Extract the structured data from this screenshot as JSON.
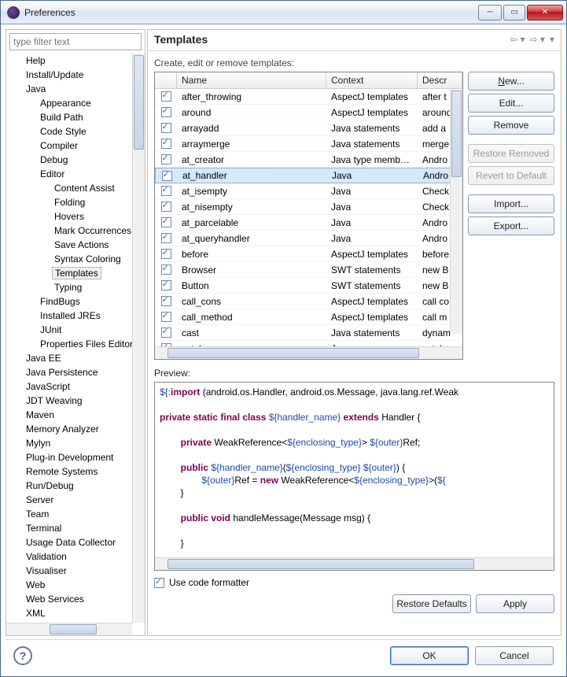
{
  "window": {
    "title": "Preferences"
  },
  "filter_placeholder": "type filter text",
  "tree": [
    {
      "label": "Help",
      "d": 0
    },
    {
      "label": "Install/Update",
      "d": 0
    },
    {
      "label": "Java",
      "d": 0
    },
    {
      "label": "Appearance",
      "d": 1
    },
    {
      "label": "Build Path",
      "d": 1
    },
    {
      "label": "Code Style",
      "d": 1
    },
    {
      "label": "Compiler",
      "d": 1
    },
    {
      "label": "Debug",
      "d": 1
    },
    {
      "label": "Editor",
      "d": 1
    },
    {
      "label": "Content Assist",
      "d": 2
    },
    {
      "label": "Folding",
      "d": 2
    },
    {
      "label": "Hovers",
      "d": 2
    },
    {
      "label": "Mark Occurrences",
      "d": 2
    },
    {
      "label": "Save Actions",
      "d": 2
    },
    {
      "label": "Syntax Coloring",
      "d": 2
    },
    {
      "label": "Templates",
      "d": 2,
      "sel": true
    },
    {
      "label": "Typing",
      "d": 2
    },
    {
      "label": "FindBugs",
      "d": 1
    },
    {
      "label": "Installed JREs",
      "d": 1
    },
    {
      "label": "JUnit",
      "d": 1
    },
    {
      "label": "Properties Files Editor",
      "d": 1
    },
    {
      "label": "Java EE",
      "d": 0
    },
    {
      "label": "Java Persistence",
      "d": 0
    },
    {
      "label": "JavaScript",
      "d": 0
    },
    {
      "label": "JDT Weaving",
      "d": 0
    },
    {
      "label": "Maven",
      "d": 0
    },
    {
      "label": "Memory Analyzer",
      "d": 0
    },
    {
      "label": "Mylyn",
      "d": 0
    },
    {
      "label": "Plug-in Development",
      "d": 0
    },
    {
      "label": "Remote Systems",
      "d": 0
    },
    {
      "label": "Run/Debug",
      "d": 0
    },
    {
      "label": "Server",
      "d": 0
    },
    {
      "label": "Team",
      "d": 0
    },
    {
      "label": "Terminal",
      "d": 0
    },
    {
      "label": "Usage Data Collector",
      "d": 0
    },
    {
      "label": "Validation",
      "d": 0
    },
    {
      "label": "Visualiser",
      "d": 0
    },
    {
      "label": "Web",
      "d": 0
    },
    {
      "label": "Web Services",
      "d": 0
    },
    {
      "label": "XML",
      "d": 0
    }
  ],
  "page": {
    "title": "Templates",
    "subhead": "Create, edit or remove templates:",
    "columns": {
      "name": "Name",
      "context": "Context",
      "desc": "Descr"
    },
    "rows": [
      {
        "name": "after_throwing",
        "ctx": "AspectJ templates",
        "desc": "after t"
      },
      {
        "name": "around",
        "ctx": "AspectJ templates",
        "desc": "around"
      },
      {
        "name": "arrayadd",
        "ctx": "Java statements",
        "desc": "add a"
      },
      {
        "name": "arraymerge",
        "ctx": "Java statements",
        "desc": "merge"
      },
      {
        "name": "at_creator",
        "ctx": "Java type members",
        "desc": "Andro"
      },
      {
        "name": "at_handler",
        "ctx": "Java",
        "desc": "Andro",
        "sel": true
      },
      {
        "name": "at_isempty",
        "ctx": "Java",
        "desc": "Check"
      },
      {
        "name": "at_nisempty",
        "ctx": "Java",
        "desc": "Check"
      },
      {
        "name": "at_parcelable",
        "ctx": "Java",
        "desc": "Andro"
      },
      {
        "name": "at_queryhandler",
        "ctx": "Java",
        "desc": "Andro"
      },
      {
        "name": "before",
        "ctx": "AspectJ templates",
        "desc": "before"
      },
      {
        "name": "Browser",
        "ctx": "SWT statements",
        "desc": "new B"
      },
      {
        "name": "Button",
        "ctx": "SWT statements",
        "desc": "new B"
      },
      {
        "name": "call_cons",
        "ctx": "AspectJ templates",
        "desc": "call co"
      },
      {
        "name": "call_method",
        "ctx": "AspectJ templates",
        "desc": "call m"
      },
      {
        "name": "cast",
        "ctx": "Java statements",
        "desc": "dynam"
      },
      {
        "name": "catch",
        "ctx": "Java",
        "desc": "catch"
      }
    ],
    "buttons": {
      "new": "New...",
      "edit": "Edit...",
      "remove": "Remove",
      "restore_removed": "Restore Removed",
      "revert_default": "Revert to Default",
      "import": "Import...",
      "export": "Export..."
    },
    "preview_label": "Preview:",
    "use_formatter": "Use code formatter",
    "restore_defaults": "Restore Defaults",
    "apply": "Apply",
    "preview_code": {
      "l1a": "${:",
      "l1b": "import",
      "l1c": " (android.os.Handler, android.os.Message, java.lang.ref.Weak",
      "l2a": "private static final class ",
      "l2b": "${handler_name}",
      "l2c": " extends ",
      "l2d": "Handler {",
      "l3a": "private ",
      "l3b": "WeakReference<",
      "l3c": "${enclosing_type}",
      "l3d": "> ",
      "l3e": "${outer}",
      "l3f": "Ref;",
      "l4a": "public ",
      "l4b": "${handler_name}",
      "l4c": "(",
      "l4d": "${enclosing_type}",
      "l4e": " ",
      "l4f": "${outer}",
      "l4g": ") {",
      "l5a": "${outer}",
      "l5b": "Ref = ",
      "l5c": "new ",
      "l5d": "WeakReference<",
      "l5e": "${enclosing_type}",
      "l5f": ">(",
      "l5g": "${",
      "l6": "}",
      "l7a": "public void ",
      "l7b": "handleMessage(Message msg) {",
      "l8": "}",
      "l9": "}"
    }
  },
  "footer": {
    "ok": "OK",
    "cancel": "Cancel"
  }
}
